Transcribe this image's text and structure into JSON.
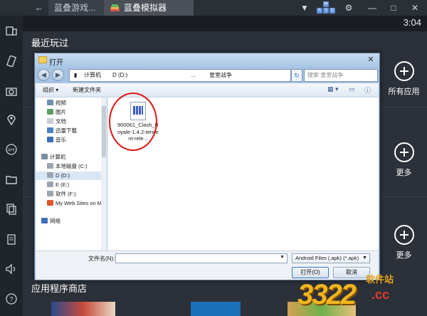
{
  "window": {
    "back_icon": "back-arrow-icon",
    "tab_inactive": "蓝叠游戏...",
    "tab_active": "蓝叠模拟器",
    "wasd": [
      "W",
      "A",
      "S",
      "D"
    ]
  },
  "status": {
    "clock": "3:04"
  },
  "home": {
    "recent_title": "最近玩过",
    "store_title": "应用程序商店",
    "right_actions": [
      {
        "label": "所有应用"
      },
      {
        "label": "更多"
      },
      {
        "label": "更多"
      }
    ]
  },
  "dialog": {
    "title": "打开",
    "close": "✕",
    "address": {
      "crumbs": [
        "计算机",
        "D (D:)",
        "...",
        "皇室战争"
      ]
    },
    "search_placeholder": "搜索 皇室战争",
    "toolbar": {
      "organize": "组织 ▾",
      "new_folder": "新建文件夹"
    },
    "nav_items": [
      {
        "label": "视频",
        "color": "#6f8fb3"
      },
      {
        "label": "图片",
        "color": "#5b9c62"
      },
      {
        "label": "文档",
        "color": "#c8ccd3"
      },
      {
        "label": "迅雷下载",
        "color": "#4a83c8"
      },
      {
        "label": "音乐",
        "color": "#3b70b8"
      },
      {
        "label": "计算机",
        "color": "#7d8ea3"
      },
      {
        "label": "本地磁盘 (C:)",
        "color": "#9aa5b1"
      },
      {
        "label": "D (D:)",
        "color": "#9aa5b1"
      },
      {
        "label": "E (E:)",
        "color": "#9aa5b1"
      },
      {
        "label": "软件 (F:)",
        "color": "#9aa5b1"
      },
      {
        "label": "My Web Sites on MSN",
        "color": "#e0542b"
      },
      {
        "label": "网络",
        "color": "#3f6fb8"
      }
    ],
    "file": {
      "name": "900061_Clash_Royale-1.4.2-tencent-rele..."
    },
    "file_name_label": "文件名(N):",
    "file_name_value": "",
    "file_type": "Android Files (.apk) (*.apk)",
    "open_button": "打开(O)",
    "cancel_button": "取消"
  },
  "watermark": {
    "top": "软件站",
    "number": "3322",
    "suffix": ".cc"
  }
}
